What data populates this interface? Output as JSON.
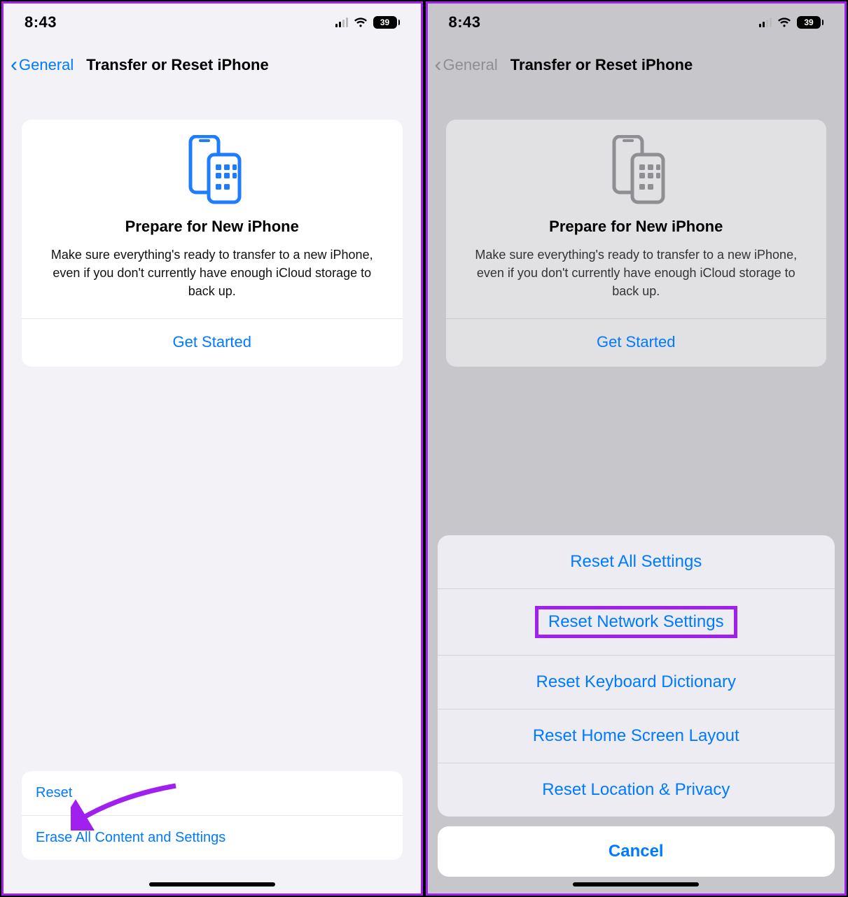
{
  "status": {
    "time": "8:43",
    "battery": "39"
  },
  "nav": {
    "back_label": "General",
    "title": "Transfer or Reset iPhone"
  },
  "card": {
    "title": "Prepare for New iPhone",
    "description": "Make sure everything's ready to transfer to a new iPhone, even if you don't currently have enough iCloud storage to back up.",
    "cta": "Get Started"
  },
  "bottom": {
    "reset": "Reset",
    "erase": "Erase All Content and Settings"
  },
  "sheet": {
    "items": [
      "Reset All Settings",
      "Reset Network Settings",
      "Reset Keyboard Dictionary",
      "Reset Home Screen Layout",
      "Reset Location & Privacy"
    ],
    "highlight_index": 1,
    "cancel": "Cancel"
  },
  "colors": {
    "accent": "#007aff",
    "annotation": "#a020f0"
  }
}
